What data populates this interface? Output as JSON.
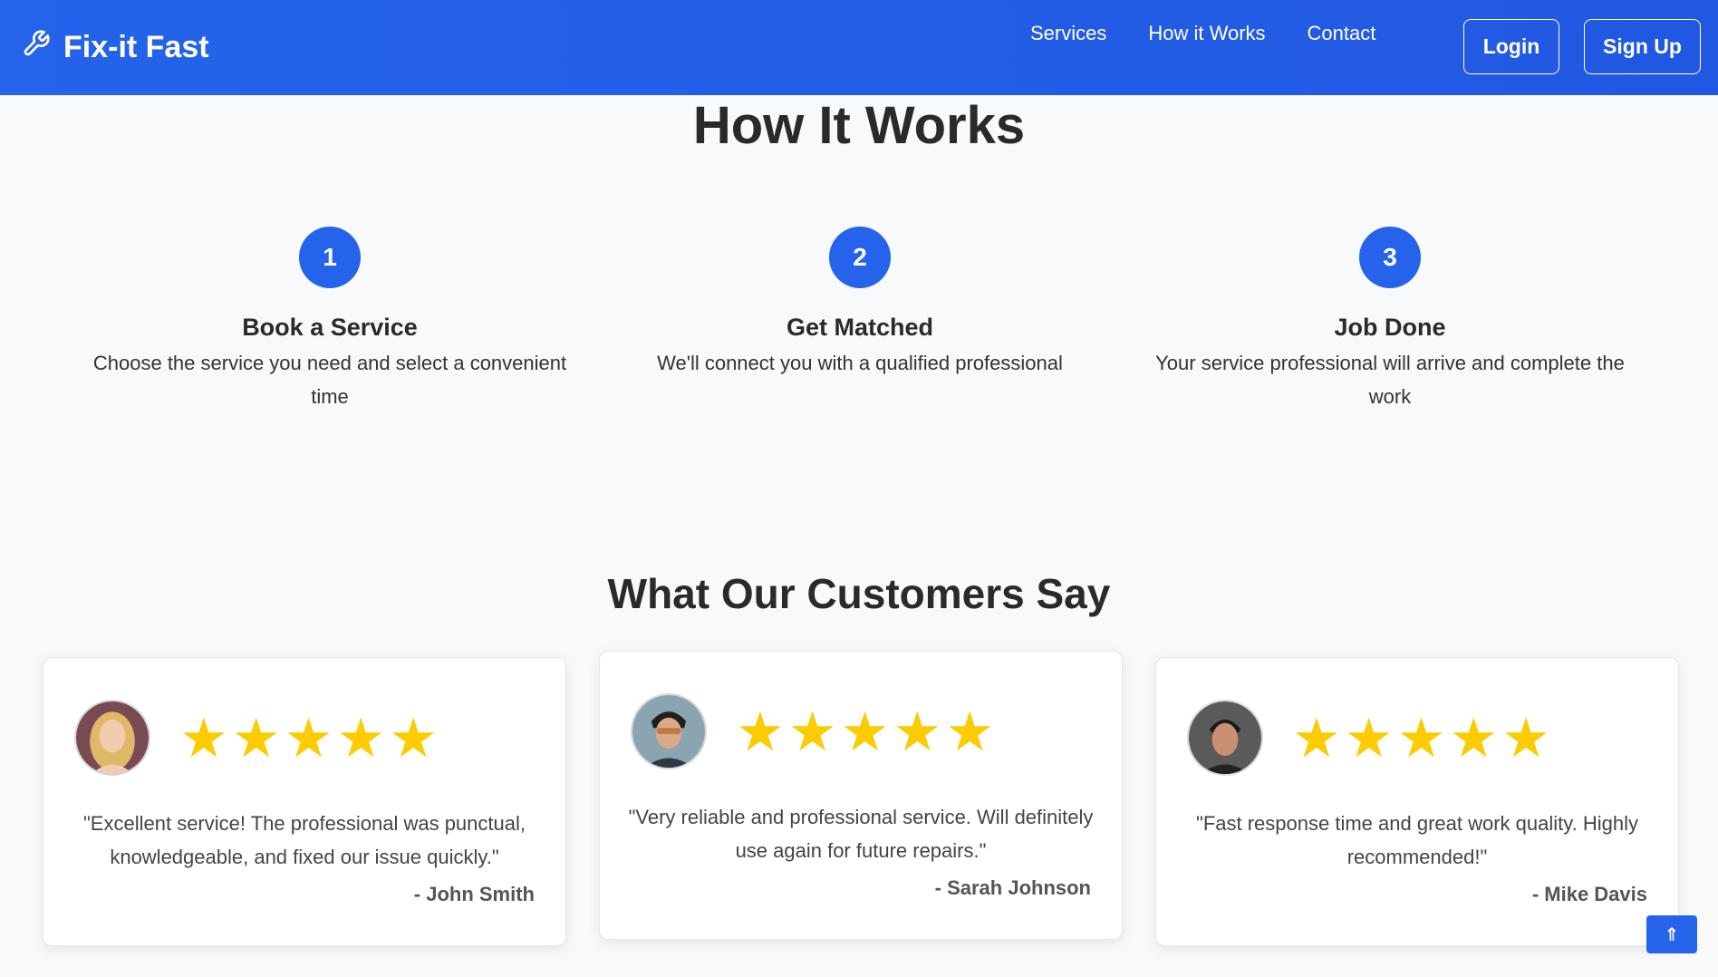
{
  "header": {
    "brand": "Fix-it Fast",
    "brand_icon": "wrench-icon",
    "nav": [
      "Services",
      "How it Works",
      "Contact"
    ],
    "login_label": "Login",
    "signup_label": "Sign Up"
  },
  "how_it_works": {
    "title": "How It Works",
    "steps": [
      {
        "number": "1",
        "title": "Book a Service",
        "description": "Choose the service you need and select a convenient time"
      },
      {
        "number": "2",
        "title": "Get Matched",
        "description": "We'll connect you with a qualified professional"
      },
      {
        "number": "3",
        "title": "Job Done",
        "description": "Your service professional will arrive and complete the work"
      }
    ]
  },
  "testimonials": {
    "title": "What Our Customers Say",
    "items": [
      {
        "rating": 5,
        "quote": "\"Excellent service! The professional was punctual, knowledgeable, and fixed our issue quickly.\"",
        "author": "- John Smith"
      },
      {
        "rating": 5,
        "quote": "\"Very reliable and professional service. Will definitely use again for future repairs.\"",
        "author": "- Sarah Johnson"
      },
      {
        "rating": 5,
        "quote": "\"Fast response time and great work quality. Highly recommended!\"",
        "author": "- Mike Davis"
      }
    ]
  },
  "scroll_top_icon": "⇑",
  "colors": {
    "primary": "#2563eb",
    "star": "#fccb00",
    "background": "#f8f9fa"
  }
}
